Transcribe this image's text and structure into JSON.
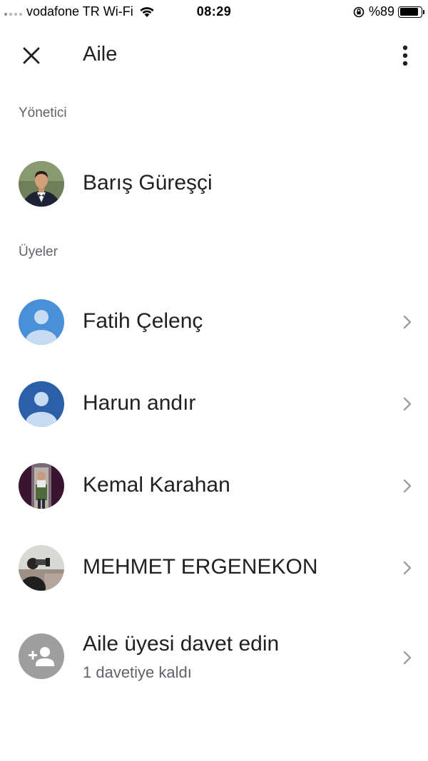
{
  "status_bar": {
    "carrier": "vodafone TR Wi-Fi",
    "time": "08:29",
    "battery": "%89",
    "battery_level": 0.89
  },
  "header": {
    "title": "Aile",
    "close_icon": "close-icon",
    "more_icon": "more-vert-icon"
  },
  "admin_section": {
    "label": "Yönetici",
    "admin": {
      "name": "Barış Güreşçi",
      "avatar": "photo-avatar"
    }
  },
  "members_section": {
    "label": "Üyeler",
    "members": [
      {
        "name": "Fatih Çelenç",
        "avatar": "default-person-avatar",
        "avatar_color": "#4a90d9"
      },
      {
        "name": "Harun andır",
        "avatar": "default-person-avatar",
        "avatar_color": "#2b5fa8"
      },
      {
        "name": "Kemal Karahan",
        "avatar": "photo-avatar"
      },
      {
        "name": "MEHMET ERGENEKON",
        "avatar": "photo-avatar"
      }
    ]
  },
  "invite": {
    "label": "Aile üyesi davet edin",
    "sublabel": "1 davetiye kaldı",
    "icon": "add-person-icon"
  }
}
